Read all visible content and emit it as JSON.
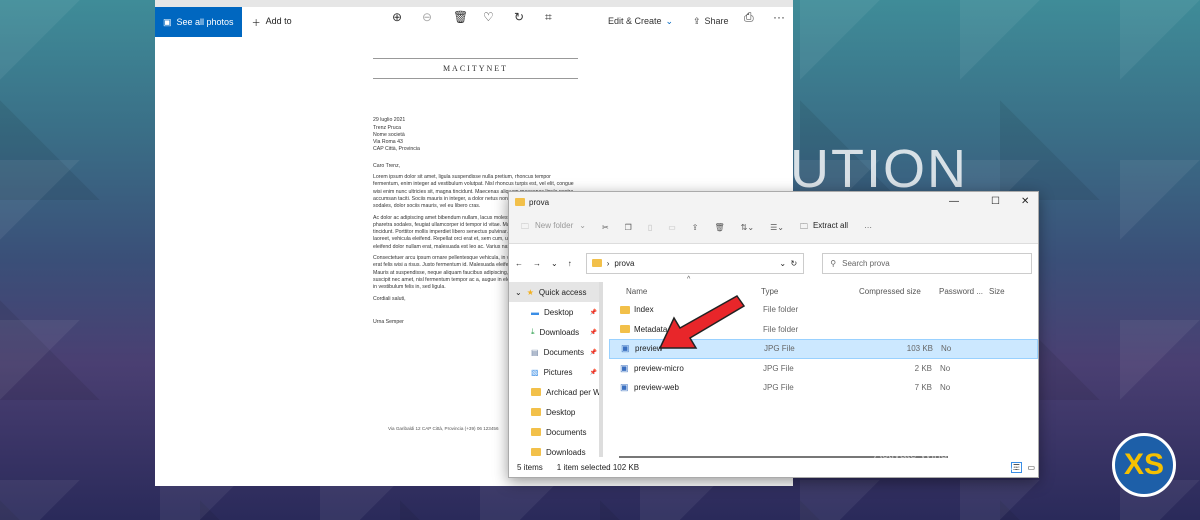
{
  "background": {
    "big_text": "UTION",
    "logo": "XS"
  },
  "photos": {
    "toolbar": {
      "see_all": "See all photos",
      "add_to": "Add to",
      "edit_create": "Edit & Create",
      "share": "Share",
      "more": "···"
    },
    "letter": {
      "heading": "MACITYNET",
      "address": [
        "29 luglio 2021",
        "Trenz Pruca",
        "Nome società",
        "Via Roma 43",
        "CAP Città, Provincia"
      ],
      "greeting": "Caro Trenz,",
      "paragraphs": [
        "Lorem ipsum dolor sit amet, ligula suspendisse nulla pretium, rhoncus tempor fermentum, enim integer ad vestibulum volutpat. Nisl rhoncus turpis est, vel elit, congue wisi enim nunc ultricies sit, magna tincidunt. Maecenas aliquam maecenas ligula nostra, accumsan taciti. Sociis mauris in integer, a dolor netus non dui aliquet, sagittis felis sodales, dolor sociis mauris, vel eu libero cras.",
        "Ac dolor ac adipiscing amet bibendum nullam, lacus molestie ut libero nec, diam et, pharetra sodales, feugiat ullamcorper id tempor id vitae. Mauris pretium aliquet, lectus tincidunt. Porttitor mollis imperdiet libero senectus pulvinar. Etiam molestie mauris ligula laoreet, vehicula eleifend. Repellat orci erat et, sem cum, ultricies sollicitudin amet eleifend dolor nullam erat, malesuada est leo ac. Varius natoque turpis elementum est.",
        "Consectetuer arcu ipsum ornare pellentesque vehicula, in vehicula diam, ornare magna erat felis wisi a risus. Justo fermentum id. Malesuada eleifend, tortor molestie, a a vel et. Mauris at suspendisse, neque aliquam faucibus adipiscing, vivamus in. Wisi mattis leo suscipit nec amet, nisl fermentum tempor ac a, augue in eleifend in venenatis, cras sit id in vestibulum felis in, sed ligula."
      ],
      "closing": "Cordiali saluti,",
      "signature": "Urna Semper",
      "footer": "Via Garibaldi 12   CAP Città, Provincia      (+39) 06 123456"
    }
  },
  "explorer": {
    "title": "prova",
    "ribbon": {
      "new_folder": "New folder",
      "extract_all": "Extract all",
      "more": "···"
    },
    "address": "prova",
    "search_placeholder": "Search prova",
    "nav": [
      {
        "label": "Quick access"
      },
      {
        "label": "Desktop",
        "pinned": true
      },
      {
        "label": "Downloads",
        "pinned": true
      },
      {
        "label": "Documents",
        "pinned": true
      },
      {
        "label": "Pictures",
        "pinned": true
      },
      {
        "label": "Archicad per W"
      },
      {
        "label": "Desktop"
      },
      {
        "label": "Documents"
      },
      {
        "label": "Downloads"
      }
    ],
    "columns": [
      "Name",
      "Type",
      "Compressed size",
      "Password ...",
      "Size"
    ],
    "files": [
      {
        "name": "Index",
        "type": "File folder",
        "compressed": "",
        "password": "",
        "folder": true
      },
      {
        "name": "Metadata",
        "type": "File folder",
        "compressed": "",
        "password": "",
        "folder": true
      },
      {
        "name": "preview",
        "type": "JPG File",
        "compressed": "103 KB",
        "password": "No",
        "selected": true
      },
      {
        "name": "preview-micro",
        "type": "JPG File",
        "compressed": "2 KB",
        "password": "No"
      },
      {
        "name": "preview-web",
        "type": "JPG File",
        "compressed": "7 KB",
        "password": "No"
      }
    ],
    "status": {
      "items": "5 items",
      "selected": "1 item selected  102 KB"
    }
  },
  "watermark": {
    "line1": "Activate Windows",
    "line2": "Go to Settings to activate Windows."
  }
}
